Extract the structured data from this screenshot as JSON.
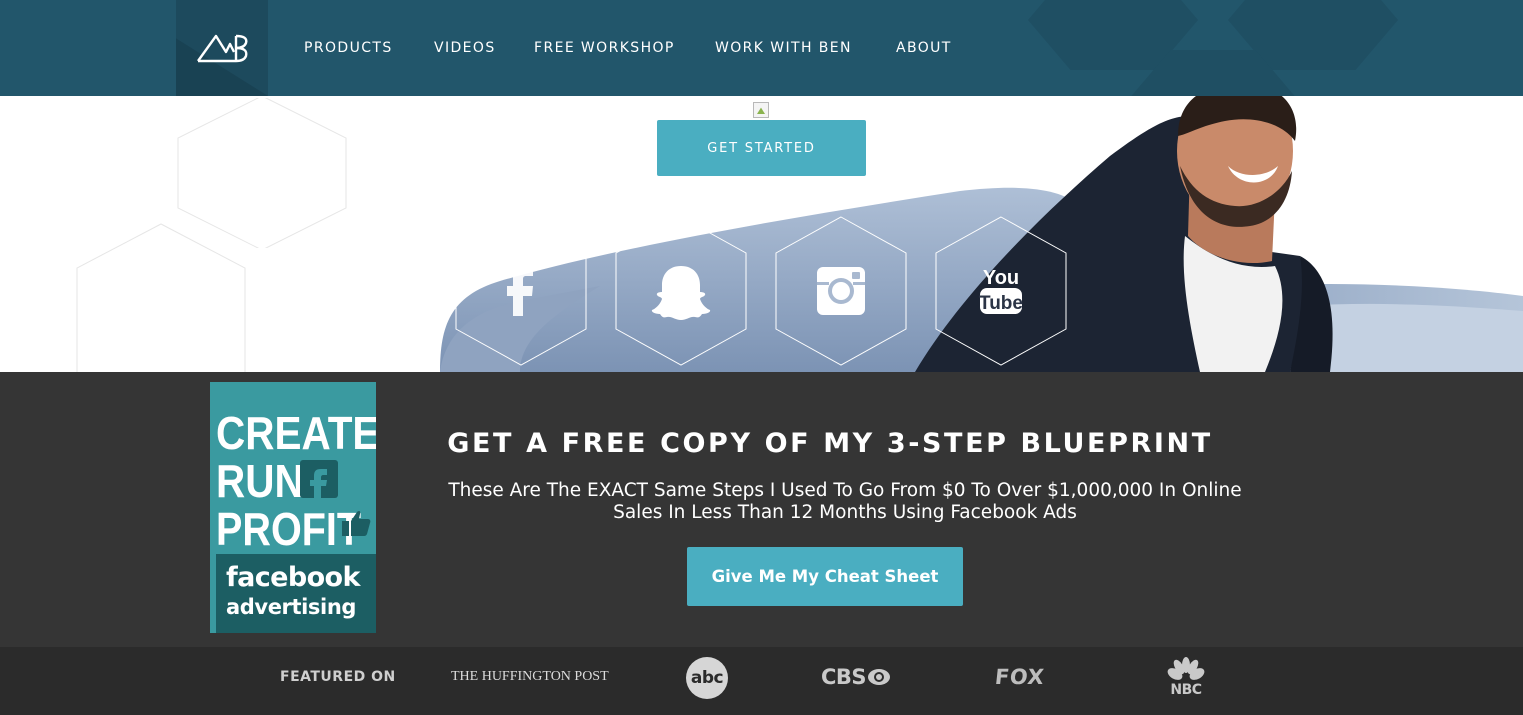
{
  "header": {
    "logo_alt": "MB",
    "nav": [
      {
        "label": "PRODUCTS"
      },
      {
        "label": "VIDEOS"
      },
      {
        "label": "FREE WORKSHOP"
      },
      {
        "label": "WORK WITH BEN"
      },
      {
        "label": "ABOUT"
      }
    ]
  },
  "hero": {
    "cta_label": "GET STARTED",
    "social": [
      {
        "icon": "facebook-icon"
      },
      {
        "icon": "snapchat-icon"
      },
      {
        "icon": "instagram-icon"
      },
      {
        "icon": "youtube-icon",
        "label_top": "You",
        "label_bottom": "Tube"
      }
    ]
  },
  "blueprint": {
    "book": {
      "line1": "CREATE",
      "line2": "RUN",
      "line3": "PROFIT",
      "sub1": "facebook",
      "sub2": "advertising"
    },
    "title": "GET A FREE COPY OF MY 3-STEP BLUEPRINT",
    "subtitle": "These Are The EXACT Same Steps I Used To Go From $0 To Over $1,000,000 In Online Sales In Less Than 12 Months Using Facebook Ads",
    "cta_label": "Give Me My Cheat Sheet"
  },
  "featured": {
    "label": "FEATURED ON",
    "outlets": [
      "THE HUFFINGTON POST",
      "abc",
      "CBS",
      "FOX",
      "NBC"
    ]
  },
  "colors": {
    "header_bg": "#22566b",
    "accent": "#4aaec1",
    "band_bg": "#353535",
    "footer_bg": "#2b2b2b"
  }
}
